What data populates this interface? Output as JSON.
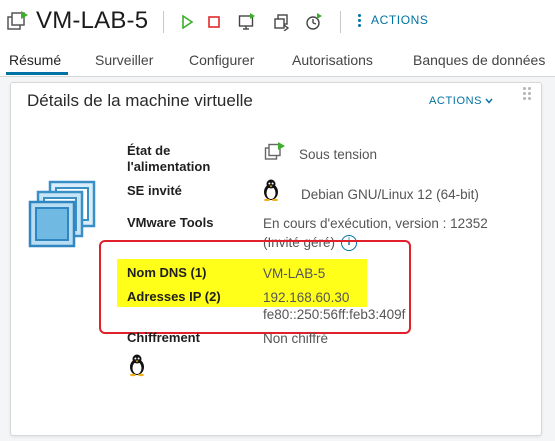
{
  "header": {
    "vm_name": "VM-LAB-5",
    "actions_label": "ACTIONS"
  },
  "tabs": [
    {
      "label": "Résumé",
      "active": true
    },
    {
      "label": "Surveiller"
    },
    {
      "label": "Configurer"
    },
    {
      "label": "Autorisations"
    },
    {
      "label": "Banques de données"
    }
  ],
  "card": {
    "title": "Détails de la machine virtuelle",
    "actions_label": "ACTIONS",
    "rows": {
      "power_label": "État de l'alimentation",
      "power_value": "Sous tension",
      "guest_os_label": "SE invité",
      "guest_os_value": "Debian GNU/Linux 12 (64-bit)",
      "tools_label": "VMware Tools",
      "tools_value_1": "En cours d'exécution, version : 12352",
      "tools_value_2": "(Invité géré)",
      "dns_label": "Nom DNS (1)",
      "dns_value": "VM-LAB-5",
      "ip_label": "Adresses IP (2)",
      "ip_value_1": "192.168.60.30",
      "ip_value_2": "fe80::250:56ff:feb3:409f",
      "encryption_label": "Chiffrement",
      "encryption_value": "Non chiffré"
    }
  },
  "colors": {
    "accent": "#0072a3",
    "play_green": "#3dae2b",
    "stop_red": "#e02b2b",
    "highlight": "#ffff1a",
    "annotation_red": "#e0202a"
  }
}
